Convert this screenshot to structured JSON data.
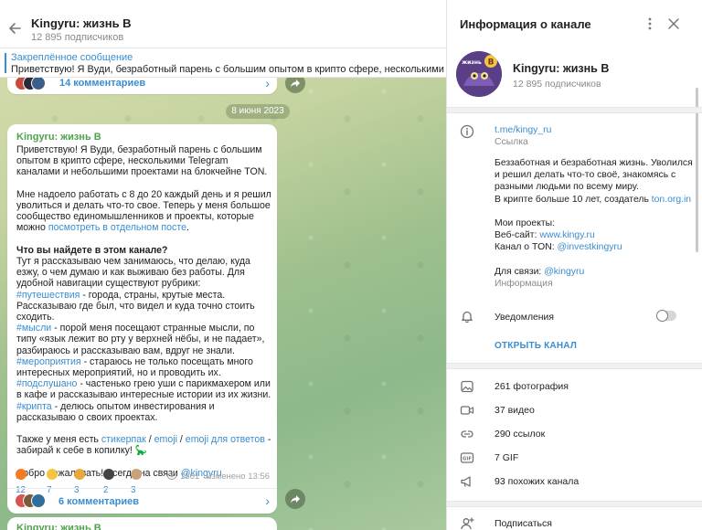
{
  "chat": {
    "title": "Kingyru: жизнь В",
    "subscribers": "12 895 подписчиков",
    "pinned": {
      "title": "Закреплённое сообщение",
      "text": "Приветствую! Я Вуди, безработный парень с большим опытом в крипто сфере, несколькими Telegram каналами..."
    },
    "prev_comments": "14 комментариев",
    "date_pill": "8 июня 2023",
    "post": {
      "author": "Kingyru: жизнь В",
      "p1": "Приветствую! Я Вуди, безработный парень с большим опытом в крипто сфере, несколькими Telegram каналами и небольшими проектами на блокчейне TON.",
      "p2a": "Мне надоело работать с 8 до 20 каждый день и я решил уволиться и делать что-то свое. Теперь у меня большое сообщество единомышленников и проекты, которые можно ",
      "p2_link": "посмотреть в отдельном посте",
      "p2b": ".",
      "h1": "Что вы найдете в этом канале?",
      "p3": "Тут я рассказываю чем занимаюсь, что делаю, куда езжу, о чем думаю и как выживаю без работы. Для удобной навигации существуют рубрики:",
      "tag1": "#путешествия",
      "tag1_text": " - города, страны, крутые места. Рассказываю где был, что видел и куда точно стоить сходить.",
      "tag2": "#мысли",
      "tag2_text": " - порой меня посещают странные мысли, по типу «язык лежит во рту у верхней нёбы, и не падает», разбираюсь и рассказываю вам, вдруг не знали.",
      "tag3": "#мероприятия",
      "tag3_text": " - стараюсь не только посещать много интересных мероприятий, но и проводить их.",
      "tag4": "#подслушано",
      "tag4_text": " - частенько грею уши с парикмахером или в кафе и рассказываю интересные истории из их жизни.",
      "tag5": "#крипта",
      "tag5_text": " - делюсь опытом инвестирования и рассказываю о своих проектах.",
      "p4a": "Также у меня есть ",
      "p4_l1": "стикерпак",
      "p4_sep1": " / ",
      "p4_l2": "emoji",
      "p4_sep2": " / ",
      "p4_l3": "emoji для ответов",
      "p4b": " - забирай к себе в копилку! 🦕",
      "p5a": "Добро пожаловать! Всегда на связи ",
      "p5_link": "@kingyru"
    },
    "reactions": [
      {
        "emoji": "fire",
        "count": "12"
      },
      {
        "emoji": "thumbs-up",
        "count": "7"
      },
      {
        "emoji": "party",
        "count": "3"
      },
      {
        "emoji": "dark",
        "count": "2"
      },
      {
        "emoji": "cat",
        "count": "3"
      }
    ],
    "views": "1561",
    "edited": "изменено 13:56",
    "post_comments": "6 комментариев",
    "next_author": "Kingyru: жизнь В"
  },
  "info": {
    "title": "Информация о канале",
    "channel_name": "Kingyru: жизнь В",
    "subscribers": "12 895 подписчиков",
    "link": "t.me/kingy_ru",
    "link_label": "Ссылка",
    "desc1": "Беззаботная и безработная жизнь. Уволился и решил делать что-то своё, знакомясь с разными людьми по всему миру.",
    "desc2a": "В крипте больше 10 лет, создатель ",
    "desc2_link": "ton.org.in",
    "projects_title": "Мои проекты:",
    "site_label": "Веб-сайт: ",
    "site_link": "www.kingy.ru",
    "ton_label": "Канал о TON: ",
    "ton_link": "@investkingyru",
    "contact_label": "Для связи: ",
    "contact_link": "@kingyru",
    "info_label": "Информация",
    "notifications": "Уведомления",
    "open_channel": "ОТКРЫТЬ КАНАЛ",
    "media": {
      "photos": "261 фотография",
      "videos": "37 видео",
      "links": "290 ссылок",
      "gifs": "7 GIF",
      "similar": "93 похожих канала"
    },
    "subscribe": "Подписаться"
  },
  "colors": {
    "accent": "#3a8dd0",
    "author": "#4fa14c"
  }
}
